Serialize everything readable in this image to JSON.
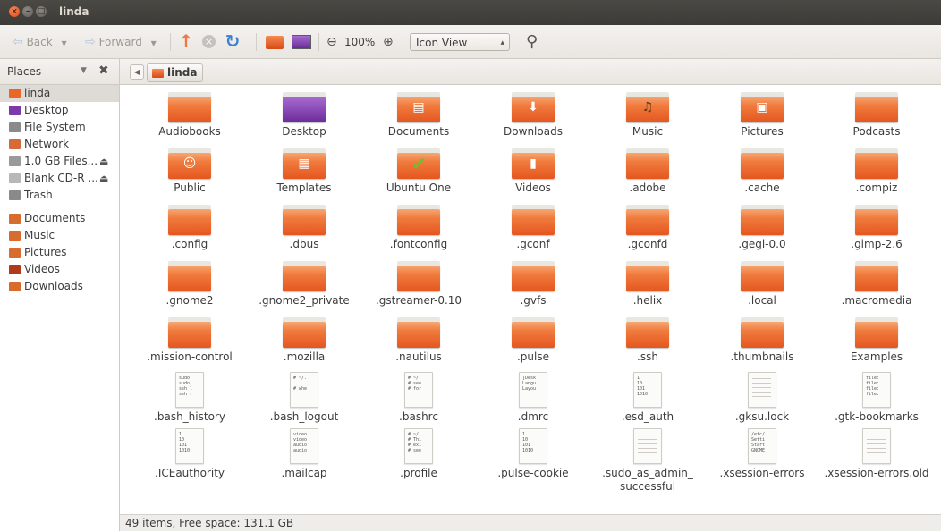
{
  "window": {
    "title": "linda"
  },
  "toolbar": {
    "back_label": "Back",
    "forward_label": "Forward",
    "zoom_level": "100%",
    "view_mode": "Icon View"
  },
  "sidebar": {
    "header": "Places",
    "items": [
      {
        "label": "linda",
        "icon": "home-folder-icon",
        "color": "#e8662a",
        "selected": true
      },
      {
        "label": "Desktop",
        "icon": "desktop-icon",
        "color": "#7b3aa8"
      },
      {
        "label": "File System",
        "icon": "harddisk-icon",
        "color": "#8a8a8a"
      },
      {
        "label": "Network",
        "icon": "network-icon",
        "color": "#d66a3a"
      },
      {
        "label": "1.0 GB Files...",
        "icon": "usb-drive-icon",
        "color": "#9a9a9a",
        "eject": true
      },
      {
        "label": "Blank CD-R ...",
        "icon": "cd-icon",
        "color": "#b8b8b8",
        "eject": true
      },
      {
        "label": "Trash",
        "icon": "trash-icon",
        "color": "#8a8a8a"
      }
    ],
    "bookmarks": [
      {
        "label": "Documents",
        "icon": "documents-icon",
        "color": "#d86b2e"
      },
      {
        "label": "Music",
        "icon": "music-icon",
        "color": "#d86b2e"
      },
      {
        "label": "Pictures",
        "icon": "pictures-icon",
        "color": "#d86b2e"
      },
      {
        "label": "Videos",
        "icon": "videos-icon",
        "color": "#b03a1a"
      },
      {
        "label": "Downloads",
        "icon": "downloads-icon",
        "color": "#d86b2e"
      }
    ]
  },
  "location": {
    "crumb": "linda"
  },
  "files": [
    {
      "name": "Audiobooks",
      "type": "folder"
    },
    {
      "name": "Desktop",
      "type": "folder",
      "variant": "desktop"
    },
    {
      "name": "Documents",
      "type": "folder",
      "emblem": "▤"
    },
    {
      "name": "Downloads",
      "type": "folder",
      "emblem": "⬇"
    },
    {
      "name": "Music",
      "type": "folder",
      "emblem": "♫",
      "variant": "music"
    },
    {
      "name": "Pictures",
      "type": "folder",
      "emblem": "▣"
    },
    {
      "name": "Podcasts",
      "type": "folder"
    },
    {
      "name": "Public",
      "type": "folder",
      "emblem": "☺"
    },
    {
      "name": "Templates",
      "type": "folder",
      "emblem": "▦"
    },
    {
      "name": "Ubuntu One",
      "type": "folder",
      "emblem": "✔",
      "variant": "ubuntu"
    },
    {
      "name": "Videos",
      "type": "folder",
      "emblem": "▮"
    },
    {
      "name": ".adobe",
      "type": "folder"
    },
    {
      "name": ".cache",
      "type": "folder"
    },
    {
      "name": ".compiz",
      "type": "folder"
    },
    {
      "name": ".config",
      "type": "folder"
    },
    {
      "name": ".dbus",
      "type": "folder"
    },
    {
      "name": ".fontconfig",
      "type": "folder"
    },
    {
      "name": ".gconf",
      "type": "folder"
    },
    {
      "name": ".gconfd",
      "type": "folder"
    },
    {
      "name": ".gegl-0.0",
      "type": "folder"
    },
    {
      "name": ".gimp-2.6",
      "type": "folder"
    },
    {
      "name": ".gnome2",
      "type": "folder"
    },
    {
      "name": ".gnome2_private",
      "type": "folder"
    },
    {
      "name": ".gstreamer-0.10",
      "type": "folder"
    },
    {
      "name": ".gvfs",
      "type": "folder"
    },
    {
      "name": ".helix",
      "type": "folder"
    },
    {
      "name": ".local",
      "type": "folder"
    },
    {
      "name": ".macromedia",
      "type": "folder"
    },
    {
      "name": ".mission-control",
      "type": "folder"
    },
    {
      "name": ".mozilla",
      "type": "folder"
    },
    {
      "name": ".nautilus",
      "type": "folder"
    },
    {
      "name": ".pulse",
      "type": "folder"
    },
    {
      "name": ".ssh",
      "type": "folder"
    },
    {
      "name": ".thumbnails",
      "type": "folder"
    },
    {
      "name": "Examples",
      "type": "folder"
    },
    {
      "name": ".bash_history",
      "type": "text",
      "preview": "sudo\nsudo\nssh l\nssh r"
    },
    {
      "name": ".bash_logout",
      "type": "text",
      "preview": "# ~/.\n\n# whe"
    },
    {
      "name": ".bashrc",
      "type": "text",
      "preview": "# ~/.\n# see\n# for"
    },
    {
      "name": ".dmrc",
      "type": "text",
      "preview": "[Desk\nLangu\nLayou"
    },
    {
      "name": ".esd_auth",
      "type": "text",
      "preview": "1\n10\n101\n1010"
    },
    {
      "name": ".gksu.lock",
      "type": "blank"
    },
    {
      "name": ".gtk-bookmarks",
      "type": "text",
      "preview": "file:\nfile:\nfile:\nfile:"
    },
    {
      "name": ".ICEauthority",
      "type": "text",
      "preview": "1\n10\n101\n1010"
    },
    {
      "name": ".mailcap",
      "type": "text",
      "preview": "video\nvideo\naudio\naudio"
    },
    {
      "name": ".profile",
      "type": "text",
      "preview": "# ~/.\n# Thi\n# exi\n# see"
    },
    {
      "name": ".pulse-cookie",
      "type": "text",
      "preview": "1\n10\n101\n1010"
    },
    {
      "name": ".sudo_as_admin_\nsuccessful",
      "type": "blank"
    },
    {
      "name": ".xsession-errors",
      "type": "text",
      "preview": "/etc/\nSetti\nStart\nGNOME"
    },
    {
      "name": ".xsession-errors.old",
      "type": "blank"
    }
  ],
  "status": {
    "text": "49 items, Free space: 131.1 GB"
  }
}
